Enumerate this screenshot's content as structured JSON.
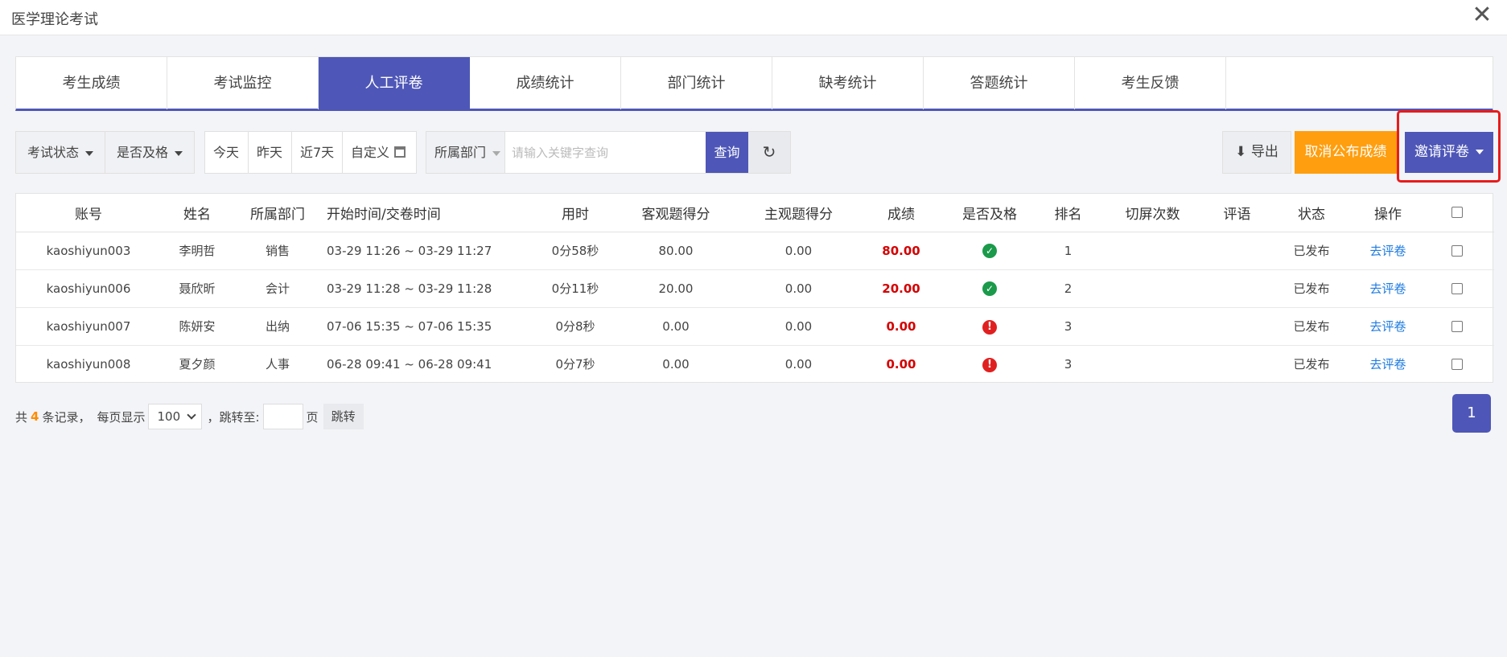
{
  "window": {
    "title": "医学理论考试",
    "close_glyph": "✕"
  },
  "tabs": [
    {
      "label": "考生成绩",
      "active": false
    },
    {
      "label": "考试监控",
      "active": false
    },
    {
      "label": "人工评卷",
      "active": true
    },
    {
      "label": "成绩统计",
      "active": false
    },
    {
      "label": "部门统计",
      "active": false
    },
    {
      "label": "缺考统计",
      "active": false
    },
    {
      "label": "答题统计",
      "active": false
    },
    {
      "label": "考生反馈",
      "active": false
    }
  ],
  "filters": {
    "status": "考试状态",
    "passed": "是否及格",
    "today": "今天",
    "yesterday": "昨天",
    "last7": "近7天",
    "custom": "自定义"
  },
  "search": {
    "dept": "所属部门",
    "placeholder": "请输入关键字查询",
    "query": "查询",
    "reset": "↻"
  },
  "actions": {
    "export": "⬇ 导出",
    "unpublish": "取消公布成绩",
    "invite": "邀请评卷"
  },
  "table": {
    "headers": [
      "账号",
      "姓名",
      "所属部门",
      "开始时间/交卷时间",
      "用时",
      "客观题得分",
      "主观题得分",
      "成绩",
      "是否及格",
      "排名",
      "切屏次数",
      "评语",
      "状态",
      "操作"
    ],
    "rows": [
      {
        "account": "kaoshiyun003",
        "name": "李明哲",
        "dept": "销售",
        "time": "03-29 11:26 ~ 03-29 11:27",
        "duration": "0分58秒",
        "objective": "80.00",
        "subjective": "0.00",
        "score": "80.00",
        "passed": true,
        "pass_icon": "✓",
        "rank": "1",
        "switches": "",
        "comment": "",
        "status": "已发布",
        "action": "去评卷"
      },
      {
        "account": "kaoshiyun006",
        "name": "聂欣昕",
        "dept": "会计",
        "time": "03-29 11:28 ~ 03-29 11:28",
        "duration": "0分11秒",
        "objective": "20.00",
        "subjective": "0.00",
        "score": "20.00",
        "passed": true,
        "pass_icon": "✓",
        "rank": "2",
        "switches": "",
        "comment": "",
        "status": "已发布",
        "action": "去评卷"
      },
      {
        "account": "kaoshiyun007",
        "name": "陈妍安",
        "dept": "出纳",
        "time": "07-06 15:35 ~ 07-06 15:35",
        "duration": "0分8秒",
        "objective": "0.00",
        "subjective": "0.00",
        "score": "0.00",
        "passed": false,
        "pass_icon": "!",
        "rank": "3",
        "switches": "",
        "comment": "",
        "status": "已发布",
        "action": "去评卷"
      },
      {
        "account": "kaoshiyun008",
        "name": "夏夕颜",
        "dept": "人事",
        "time": "06-28 09:41 ~ 06-28 09:41",
        "duration": "0分7秒",
        "objective": "0.00",
        "subjective": "0.00",
        "score": "0.00",
        "passed": false,
        "pass_icon": "!",
        "rank": "3",
        "switches": "",
        "comment": "",
        "status": "已发布",
        "action": "去评卷"
      }
    ]
  },
  "pager": {
    "prefix": "共",
    "total": "4",
    "suffix": "条记录，",
    "per_page_label": "每页显示",
    "per_page": "100",
    "jump_label": "，跳转至:",
    "page_unit": "页",
    "jump_button": "跳转",
    "current_page": "1"
  },
  "colors": {
    "accent": "#4e57b7",
    "orange": "#ff9e0e",
    "score_red": "#d40000",
    "pass_green": "#1a9a4a",
    "fail_red": "#e02020",
    "link_blue": "#1e7be0",
    "highlight": "#e81b1b"
  }
}
